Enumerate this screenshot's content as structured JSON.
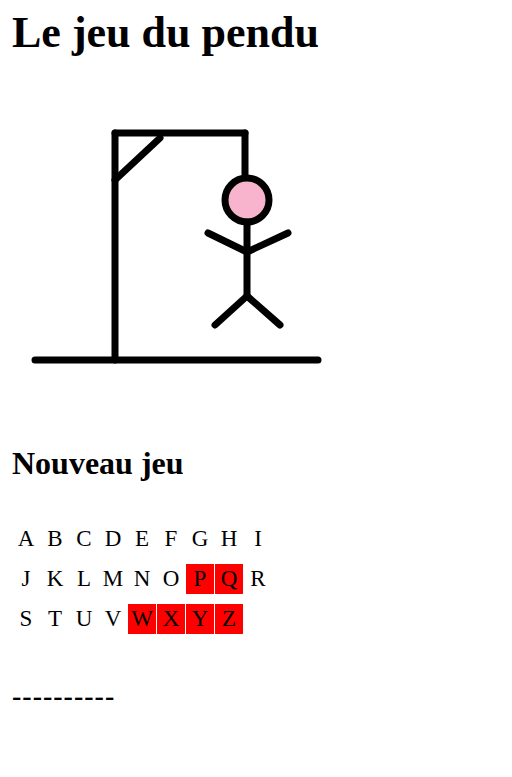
{
  "title": "Le jeu du pendu",
  "hangman": {
    "errors": 6
  },
  "new_game": "Nouveau jeu",
  "keyboard": [
    [
      {
        "letter": "A",
        "used": false
      },
      {
        "letter": "B",
        "used": false
      },
      {
        "letter": "C",
        "used": false
      },
      {
        "letter": "D",
        "used": false
      },
      {
        "letter": "E",
        "used": false
      },
      {
        "letter": "F",
        "used": false
      },
      {
        "letter": "G",
        "used": false
      },
      {
        "letter": "H",
        "used": false
      },
      {
        "letter": "I",
        "used": false
      }
    ],
    [
      {
        "letter": "J",
        "used": false
      },
      {
        "letter": "K",
        "used": false
      },
      {
        "letter": "L",
        "used": false
      },
      {
        "letter": "M",
        "used": false
      },
      {
        "letter": "N",
        "used": false
      },
      {
        "letter": "O",
        "used": false
      },
      {
        "letter": "P",
        "used": true
      },
      {
        "letter": "Q",
        "used": true
      },
      {
        "letter": "R",
        "used": false
      }
    ],
    [
      {
        "letter": "S",
        "used": false
      },
      {
        "letter": "T",
        "used": false
      },
      {
        "letter": "U",
        "used": false
      },
      {
        "letter": "V",
        "used": false
      },
      {
        "letter": "W",
        "used": true
      },
      {
        "letter": "X",
        "used": true
      },
      {
        "letter": "Y",
        "used": true
      },
      {
        "letter": "Z",
        "used": true
      }
    ]
  ],
  "word": "----------"
}
